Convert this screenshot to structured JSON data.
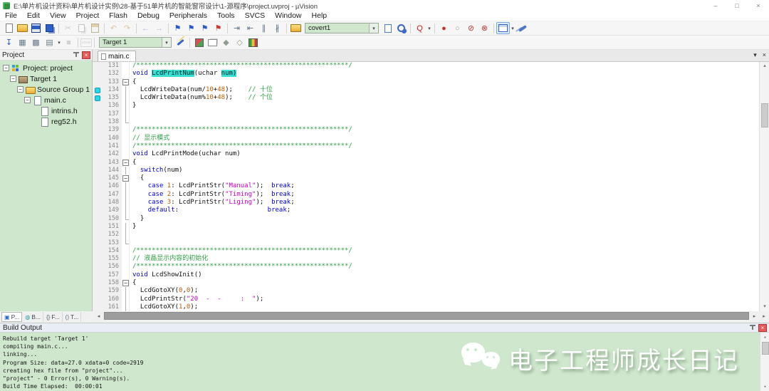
{
  "window": {
    "title": "E:\\单片机设计资料\\单片机设计实例\\28-基于51单片机的智能窗帘设计\\1-源程序\\project.uvproj - µVision",
    "controls": [
      {
        "name": "minimize-button",
        "glyph": "–"
      },
      {
        "name": "maximize-button",
        "glyph": "□"
      },
      {
        "name": "close-button",
        "glyph": "×"
      }
    ]
  },
  "menus": [
    "File",
    "Edit",
    "View",
    "Project",
    "Flash",
    "Debug",
    "Peripherals",
    "Tools",
    "SVCS",
    "Window",
    "Help"
  ],
  "toolbar": {
    "find_text": "covert1",
    "target_name": "Target 1",
    "row1": [
      {
        "t": "i",
        "name": "new-file-icon"
      },
      {
        "t": "i",
        "name": "open-folder-icon"
      },
      {
        "t": "i",
        "name": "save-icon"
      },
      {
        "t": "i",
        "name": "save-all-icon"
      },
      {
        "t": "sep"
      },
      {
        "t": "i",
        "name": "cut-icon",
        "glyph": "✂",
        "color": "#888f96",
        "dim": 1
      },
      {
        "t": "i",
        "name": "copy-icon",
        "dim": 1
      },
      {
        "t": "i",
        "name": "paste-icon",
        "dim": 1
      },
      {
        "t": "sep"
      },
      {
        "t": "i",
        "name": "undo-icon",
        "glyph": "↶",
        "color": "#c08a3a",
        "dim": 1
      },
      {
        "t": "i",
        "name": "redo-icon",
        "glyph": "↷",
        "color": "#c08a3a",
        "dim": 1
      },
      {
        "t": "sep"
      },
      {
        "t": "i",
        "name": "nav-back-icon",
        "glyph": "←",
        "color": "#4a78c8",
        "dim": 1
      },
      {
        "t": "i",
        "name": "nav-forward-icon",
        "glyph": "→",
        "color": "#4a78c8",
        "dim": 1
      },
      {
        "t": "sep"
      },
      {
        "t": "i",
        "name": "bookmark-toggle-icon",
        "glyph": "⚑",
        "color": "#2a5ac8"
      },
      {
        "t": "i",
        "name": "bookmark-prev-icon",
        "glyph": "⚑",
        "color": "#2a5ac8"
      },
      {
        "t": "i",
        "name": "bookmark-next-icon",
        "glyph": "⚑",
        "color": "#2a5ac8"
      },
      {
        "t": "i",
        "name": "bookmark-clear-icon",
        "glyph": "⚑",
        "color": "#c23a3a"
      },
      {
        "t": "sep"
      },
      {
        "t": "i",
        "name": "indent-icon",
        "glyph": "⇥",
        "color": "#5c7088"
      },
      {
        "t": "i",
        "name": "outdent-icon",
        "glyph": "⇤",
        "color": "#5c7088"
      },
      {
        "t": "i",
        "name": "comment-icon",
        "glyph": "∥",
        "color": "#5c7088"
      },
      {
        "t": "i",
        "name": "uncomment-icon",
        "glyph": "∦",
        "color": "#5c7088"
      },
      {
        "t": "sep"
      },
      {
        "t": "i",
        "name": "find-folder-icon"
      },
      {
        "t": "combo",
        "name": "search-combo",
        "bind": "find_text",
        "width": 104
      },
      {
        "t": "i",
        "name": "find-in-files-icon"
      },
      {
        "t": "i",
        "name": "find-next-icon"
      },
      {
        "t": "sep"
      },
      {
        "t": "i",
        "name": "debug-search-icon",
        "glyph": "Q",
        "color": "#c42020",
        "dd": 1
      },
      {
        "t": "sep"
      },
      {
        "t": "i",
        "name": "breakpoint-icon",
        "glyph": "●",
        "color": "#d03030"
      },
      {
        "t": "i",
        "name": "breakpoint-disabled-icon",
        "glyph": "○",
        "color": "#9a9a9a"
      },
      {
        "t": "i",
        "name": "breakpoint-disable-all-icon",
        "glyph": "⊘",
        "color": "#c23a3a"
      },
      {
        "t": "i",
        "name": "breakpoint-kill-all-icon",
        "glyph": "⊗",
        "color": "#c23a3a"
      },
      {
        "t": "sep"
      },
      {
        "t": "i",
        "name": "window-layout-icon",
        "boxed": 1,
        "dd": 1
      },
      {
        "t": "i",
        "name": "wrench-icon"
      }
    ],
    "row2": [
      {
        "t": "i",
        "name": "download-flash-icon",
        "glyph": "↧",
        "color": "#2a5ac8"
      },
      {
        "t": "i",
        "name": "build-icon",
        "glyph": "▦",
        "color": "#6a7a8a"
      },
      {
        "t": "i",
        "name": "rebuild-icon",
        "glyph": "▩",
        "color": "#6a7a8a"
      },
      {
        "t": "i",
        "name": "batch-build-icon",
        "glyph": "▤",
        "color": "#6a7a8a",
        "dd": 1
      },
      {
        "t": "i",
        "name": "stop-build-icon",
        "glyph": "■",
        "color": "#a8a8a8",
        "dim": 1
      },
      {
        "t": "sep"
      },
      {
        "t": "i",
        "name": "load-debug-icon",
        "glyph": "LOAD",
        "dim": 1
      },
      {
        "t": "sep"
      },
      {
        "t": "combo",
        "name": "target-combo",
        "bind": "target_name",
        "width": 102
      },
      {
        "t": "i",
        "name": "options-target-icon"
      },
      {
        "t": "sep"
      },
      {
        "t": "i",
        "name": "manage-components-icon"
      },
      {
        "t": "i",
        "name": "manage-books-icon"
      },
      {
        "t": "i",
        "name": "flash-diamond-icon",
        "glyph": "◆",
        "color": "#8f9e8f"
      },
      {
        "t": "i",
        "name": "flash-diamond2-icon",
        "glyph": "◇",
        "color": "#8f9e8f"
      },
      {
        "t": "i",
        "name": "pack-installer-icon"
      }
    ]
  },
  "project_panel": {
    "title": "Project",
    "tree": [
      {
        "label": "Project: project",
        "icon": "project",
        "depth": 0,
        "exp": true
      },
      {
        "label": "Target 1",
        "icon": "target",
        "depth": 1,
        "exp": true
      },
      {
        "label": "Source Group 1",
        "icon": "folder",
        "depth": 2,
        "exp": true
      },
      {
        "label": "main.c",
        "icon": "file",
        "depth": 3,
        "exp": true
      },
      {
        "label": "intrins.h",
        "icon": "file",
        "depth": 4,
        "exp": false
      },
      {
        "label": "reg52.h",
        "icon": "file",
        "depth": 4,
        "exp": false
      }
    ]
  },
  "editor": {
    "tab_label": "main.c",
    "lines": [
      {
        "n": 131,
        "g": "",
        "m": false,
        "s": [
          [
            "c",
            "/*******************************************************/"
          ]
        ]
      },
      {
        "n": 132,
        "g": "",
        "m": false,
        "s": [
          [
            "k",
            "void"
          ],
          [
            "p",
            " "
          ],
          [
            "h",
            "LcdPrintNum"
          ],
          [
            "p",
            "("
          ],
          [
            "p",
            "uchar"
          ],
          [
            "p",
            " "
          ],
          [
            "h",
            "num)"
          ]
        ]
      },
      {
        "n": 133,
        "g": "-",
        "m": false,
        "s": [
          [
            "p",
            "{"
          ]
        ]
      },
      {
        "n": 134,
        "g": "|",
        "m": true,
        "s": [
          [
            "p",
            "  LcdWriteData(num/"
          ],
          [
            "n",
            "10"
          ],
          [
            "p",
            "+"
          ],
          [
            "n",
            "48"
          ],
          [
            "p",
            ");    "
          ],
          [
            "c",
            "// 十位"
          ]
        ]
      },
      {
        "n": 135,
        "g": "|",
        "m": true,
        "s": [
          [
            "p",
            "  LcdWriteData(num%"
          ],
          [
            "n",
            "10"
          ],
          [
            "p",
            "+"
          ],
          [
            "n",
            "48"
          ],
          [
            "p",
            ");    "
          ],
          [
            "c",
            "// 个位"
          ]
        ]
      },
      {
        "n": 136,
        "g": "|",
        "m": false,
        "s": [
          [
            "p",
            "}"
          ]
        ]
      },
      {
        "n": 137,
        "g": "|",
        "m": false,
        "s": []
      },
      {
        "n": 138,
        "g": "L",
        "m": false,
        "s": []
      },
      {
        "n": 139,
        "g": "",
        "m": false,
        "s": [
          [
            "c",
            "/*******************************************************/"
          ]
        ]
      },
      {
        "n": 140,
        "g": "",
        "m": false,
        "s": [
          [
            "c",
            "// 显示模式"
          ]
        ]
      },
      {
        "n": 141,
        "g": "",
        "m": false,
        "s": [
          [
            "c",
            "/*******************************************************/"
          ]
        ]
      },
      {
        "n": 142,
        "g": "",
        "m": false,
        "s": [
          [
            "k",
            "void"
          ],
          [
            "p",
            " LcdPrintMode(uchar num)"
          ]
        ]
      },
      {
        "n": 143,
        "g": "-",
        "m": false,
        "s": [
          [
            "p",
            "{"
          ]
        ]
      },
      {
        "n": 144,
        "g": "|",
        "m": false,
        "s": [
          [
            "p",
            "  "
          ],
          [
            "k",
            "switch"
          ],
          [
            "p",
            "(num)"
          ]
        ]
      },
      {
        "n": 145,
        "g": "-",
        "m": false,
        "s": [
          [
            "p",
            "  {"
          ]
        ]
      },
      {
        "n": 146,
        "g": "|",
        "m": false,
        "s": [
          [
            "p",
            "    "
          ],
          [
            "k",
            "case"
          ],
          [
            "p",
            " "
          ],
          [
            "n",
            "1"
          ],
          [
            "p",
            ": LcdPrintStr("
          ],
          [
            "s",
            "\"Manual\""
          ],
          [
            "p",
            ");  "
          ],
          [
            "k",
            "break"
          ],
          [
            "p",
            ";"
          ]
        ]
      },
      {
        "n": 147,
        "g": "|",
        "m": false,
        "s": [
          [
            "p",
            "    "
          ],
          [
            "k",
            "case"
          ],
          [
            "p",
            " "
          ],
          [
            "n",
            "2"
          ],
          [
            "p",
            ": LcdPrintStr("
          ],
          [
            "s",
            "\"Timing\""
          ],
          [
            "p",
            ");  "
          ],
          [
            "k",
            "break"
          ],
          [
            "p",
            ";"
          ]
        ]
      },
      {
        "n": 148,
        "g": "|",
        "m": false,
        "s": [
          [
            "p",
            "    "
          ],
          [
            "k",
            "case"
          ],
          [
            "p",
            " "
          ],
          [
            "n",
            "3"
          ],
          [
            "p",
            ": LcdPrintStr("
          ],
          [
            "s",
            "\"Liging\""
          ],
          [
            "p",
            ");  "
          ],
          [
            "k",
            "break"
          ],
          [
            "p",
            ";"
          ]
        ]
      },
      {
        "n": 149,
        "g": "|",
        "m": false,
        "s": [
          [
            "p",
            "    "
          ],
          [
            "k",
            "default"
          ],
          [
            "p",
            ":                       "
          ],
          [
            "k",
            "break"
          ],
          [
            "p",
            ";"
          ]
        ]
      },
      {
        "n": 150,
        "g": "L",
        "m": false,
        "s": [
          [
            "p",
            "  }"
          ]
        ]
      },
      {
        "n": 151,
        "g": "|",
        "m": false,
        "s": [
          [
            "p",
            "}"
          ]
        ]
      },
      {
        "n": 152,
        "g": "|",
        "m": false,
        "s": []
      },
      {
        "n": 153,
        "g": "L",
        "m": false,
        "s": []
      },
      {
        "n": 154,
        "g": "",
        "m": false,
        "s": [
          [
            "c",
            "/*******************************************************/"
          ]
        ]
      },
      {
        "n": 155,
        "g": "",
        "m": false,
        "s": [
          [
            "c",
            "// 液晶显示内容的初始化"
          ]
        ]
      },
      {
        "n": 156,
        "g": "",
        "m": false,
        "s": [
          [
            "c",
            "/*******************************************************/"
          ]
        ]
      },
      {
        "n": 157,
        "g": "",
        "m": false,
        "s": [
          [
            "k",
            "void"
          ],
          [
            "p",
            " LcdShowInit()"
          ]
        ]
      },
      {
        "n": 158,
        "g": "-",
        "m": false,
        "s": [
          [
            "p",
            "{"
          ]
        ]
      },
      {
        "n": 159,
        "g": "|",
        "m": false,
        "s": [
          [
            "p",
            "  LcdGotoXY("
          ],
          [
            "n",
            "0"
          ],
          [
            "p",
            ","
          ],
          [
            "n",
            "0"
          ],
          [
            "p",
            ");"
          ]
        ]
      },
      {
        "n": 160,
        "g": "|",
        "m": false,
        "s": [
          [
            "p",
            "  LcdPrintStr("
          ],
          [
            "s",
            "\"20  -  -     :  \""
          ],
          [
            "p",
            ");"
          ]
        ]
      },
      {
        "n": 161,
        "g": "|",
        "m": false,
        "s": [
          [
            "p",
            "  LcdGotoXY("
          ],
          [
            "n",
            "1"
          ],
          [
            "p",
            ","
          ],
          [
            "n",
            "0"
          ],
          [
            "p",
            ");"
          ]
        ]
      }
    ]
  },
  "dock_tabs": [
    {
      "label": "P...",
      "icon": "▣",
      "color": "#2a68c8",
      "active": true,
      "name": "dock-tab-project"
    },
    {
      "label": "B...",
      "icon": "◍",
      "color": "#2a9aa8",
      "active": false,
      "name": "dock-tab-books"
    },
    {
      "label": "F...",
      "icon": "{}",
      "color": "#5a6a7a",
      "active": false,
      "name": "dock-tab-functions"
    },
    {
      "label": "T...",
      "icon": "()",
      "color": "#5a6a7a",
      "active": false,
      "name": "dock-tab-templates"
    }
  ],
  "build_output": {
    "title": "Build Output",
    "lines": [
      "Rebuild target 'Target 1'",
      "compiling main.c...",
      "linking...",
      "Program Size: data=27.0 xdata=0 code=2919",
      "creating hex file from \"project\"...",
      "\"project\" - 0 Error(s), 0 Warning(s).",
      "Build Time Elapsed:  00:00:01"
    ]
  },
  "watermark": {
    "text": "电子工程师成长日记",
    "icon": "wechat-logo"
  },
  "colors": {
    "panel_green": "#cfe8cd",
    "bookmark_cyan": "#27d7e2",
    "highlight_cyan": "#38dfd2",
    "comment_green": "#2f9e44",
    "keyword_blue": "#0000cc",
    "number_orange": "#c05a00",
    "string_magenta": "#c000c0"
  }
}
